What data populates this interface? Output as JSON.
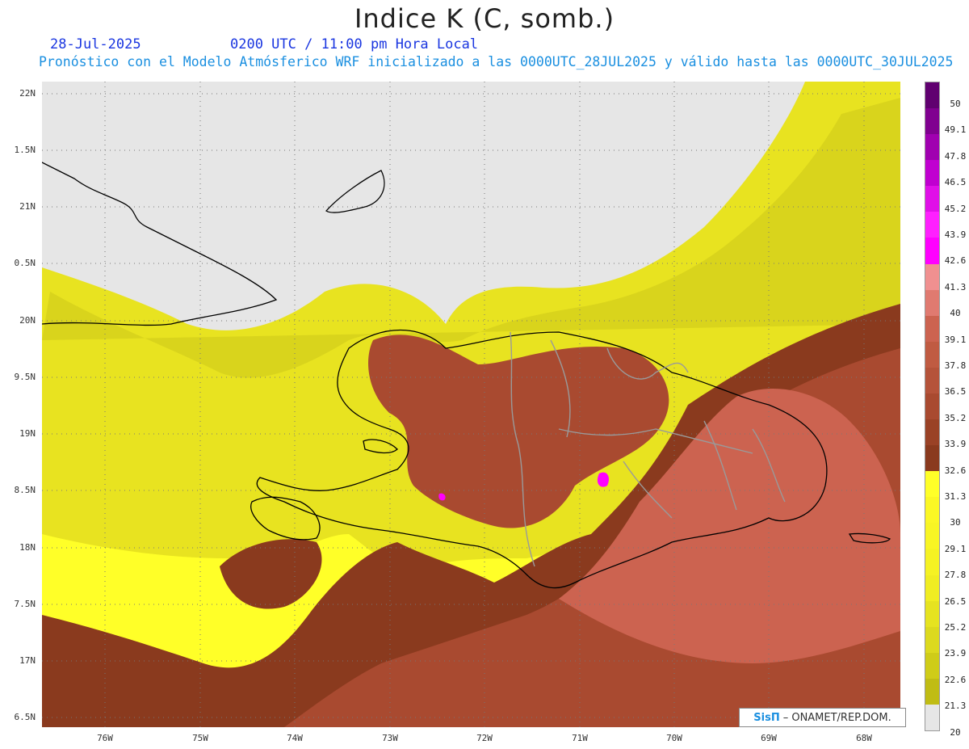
{
  "title": "Indice K (C, somb.)",
  "header": {
    "date": "28-Jul-2025",
    "time": "0200 UTC / 11:00 pm Hora Local",
    "description": "Pronóstico con el Modelo Atmósferico WRF inicializado a las 0000UTC_28JUL2025 y válido hasta las  0000UTC_30JUL2025"
  },
  "axes": {
    "lat_labels": [
      "22N",
      "1.5N",
      "21N",
      "0.5N",
      "20N",
      "9.5N",
      "19N",
      "8.5N",
      "18N",
      "7.5N",
      "17N",
      "6.5N"
    ],
    "lon_labels": [
      "76W",
      "75W",
      "74W",
      "73W",
      "72W",
      "71W",
      "70W",
      "69W",
      "68W"
    ]
  },
  "colorbar": {
    "labels": [
      "50",
      "49.1",
      "47.8",
      "46.5",
      "45.2",
      "43.9",
      "42.6",
      "41.3",
      "40",
      "39.1",
      "37.8",
      "36.5",
      "35.2",
      "33.9",
      "32.6",
      "31.3",
      "30",
      "29.1",
      "27.8",
      "26.5",
      "25.2",
      "23.9",
      "22.6",
      "21.3",
      "20"
    ],
    "colors": [
      "#e6e6e6",
      "#c0bc14",
      "#cfcc18",
      "#dcd91e",
      "#e6e320",
      "#f0ed22",
      "#f5f223",
      "#f8f524",
      "#fbf725",
      "#ffff28",
      "#8a3a1e",
      "#9a4226",
      "#a94a30",
      "#b5533a",
      "#c05b42",
      "#cc6350",
      "#e07a70",
      "#f09090",
      "#ff00ff",
      "#ff20ff",
      "#e010e8",
      "#c000d0",
      "#a000b0",
      "#800090",
      "#600070"
    ]
  },
  "credit": {
    "logo": "SisΠ",
    "text": "– ONAMET/REP.DOM."
  }
}
